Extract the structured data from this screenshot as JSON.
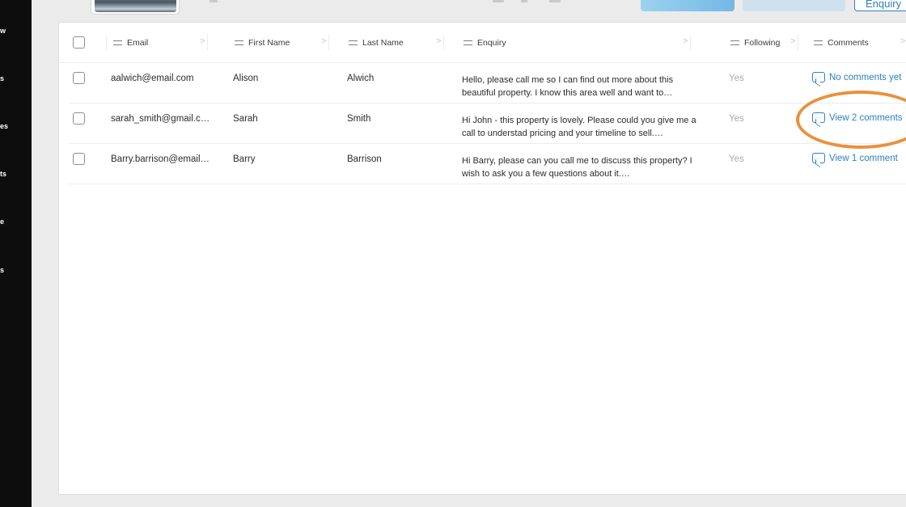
{
  "sidebar": {
    "items": [
      {
        "label": "w"
      },
      {
        "label": "s"
      },
      {
        "label": "es"
      },
      {
        "label": "ts"
      },
      {
        "label": "e"
      },
      {
        "label": "s"
      }
    ]
  },
  "topbar": {
    "enquiry_button_label": "Enquiry"
  },
  "table": {
    "columns": [
      {
        "label": "Email"
      },
      {
        "label": "First Name"
      },
      {
        "label": "Last Name"
      },
      {
        "label": "Enquiry"
      },
      {
        "label": "Following"
      },
      {
        "label": "Comments"
      }
    ],
    "rows": [
      {
        "email": "aalwich@email.com",
        "first_name": "Alison",
        "last_name": "Alwich",
        "enquiry": "Hello, please call me so I can find out more about this beautiful property. I know this area well and want to…",
        "following": "Yes",
        "comments": "No comments yet"
      },
      {
        "email": "sarah_smith@gmail.c…",
        "first_name": "Sarah",
        "last_name": "Smith",
        "enquiry": "Hi John - this property is lovely. Please could you give me a call to understad pricing and your timeline to sell.…",
        "following": "Yes",
        "comments": "View 2 comments"
      },
      {
        "email": "Barry.barrison@email…",
        "first_name": "Barry",
        "last_name": "Barrison",
        "enquiry": "Hi Barry, please can you call me to discuss this property? I wish to ask you a few questions about it.…",
        "following": "Yes",
        "comments": "View 1 comment"
      }
    ]
  },
  "colors": {
    "accent": "#2d7fc1",
    "highlight": "#e8913c",
    "sidebar": "#0d0d0d",
    "muted_text": "#a9a9a9"
  }
}
